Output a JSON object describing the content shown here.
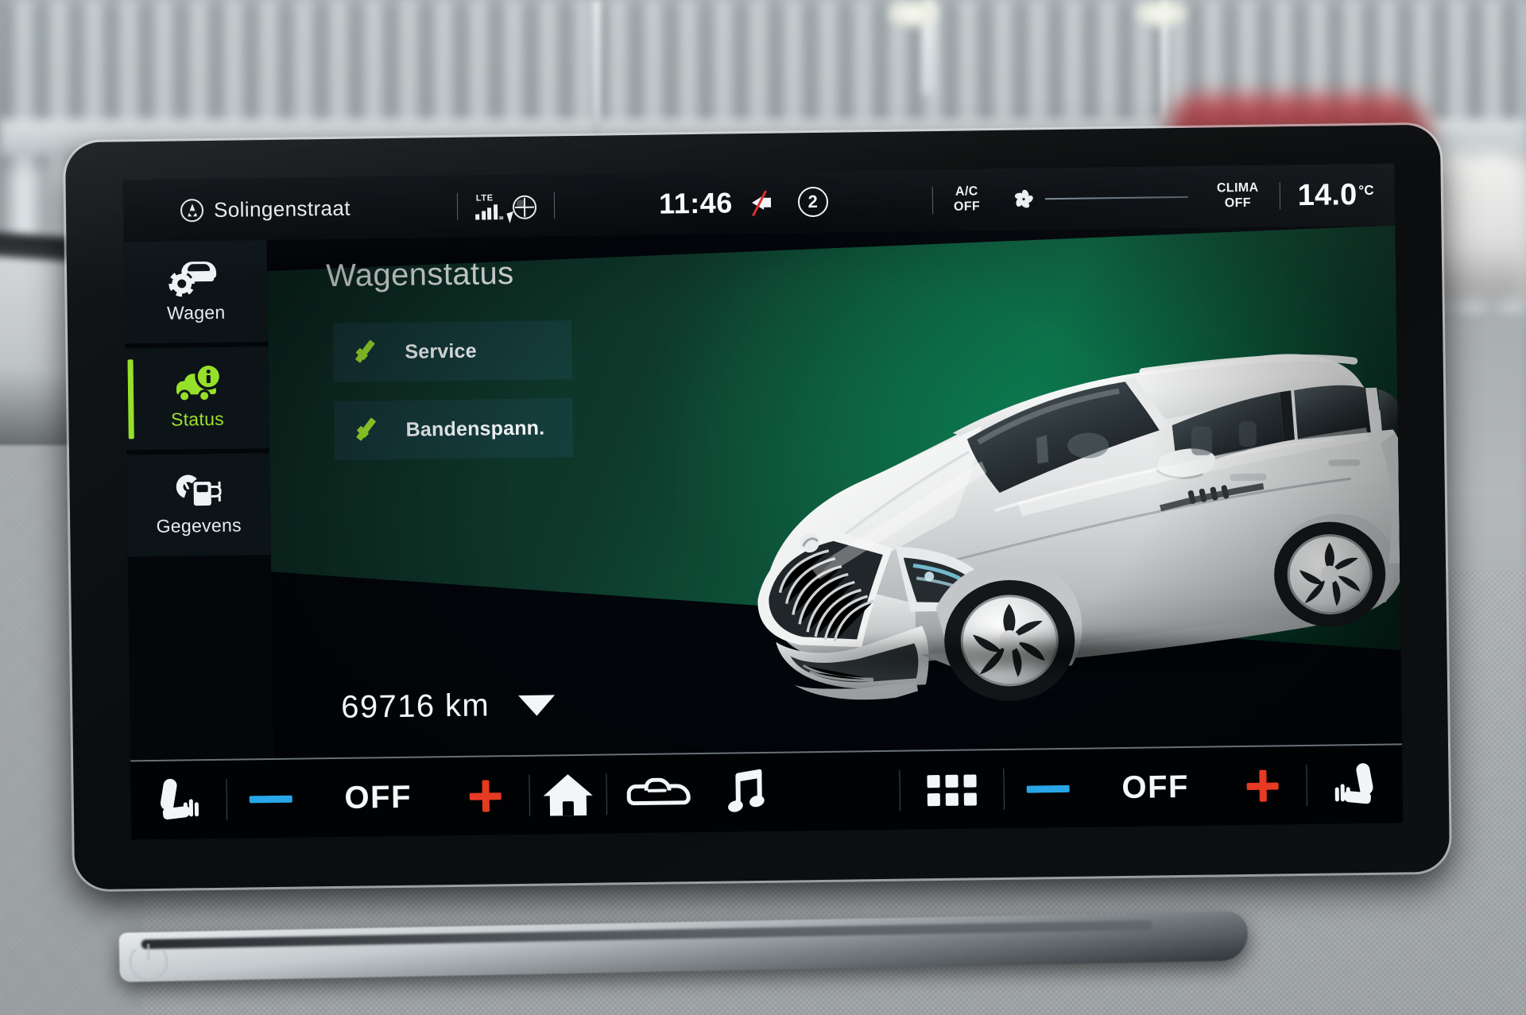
{
  "status_bar": {
    "nav_icon": "navigation-compass-icon",
    "street_name": "Solingenstraat",
    "network_label": "LTE",
    "signal_icon": "signal-bars-icon",
    "globe_icon": "globe-online-icon",
    "time": "11:46",
    "mute_icon": "speaker-muted-icon",
    "profile_number": "2",
    "ac_label_line1": "A/C",
    "ac_label_line2": "OFF",
    "fan_icon": "fan-blower-icon",
    "clima_label_line1": "CLIMA",
    "clima_label_line2": "OFF",
    "temperature": "14.0",
    "temperature_unit": "°C"
  },
  "sidebar": {
    "items": [
      {
        "label": "Wagen",
        "icon": "car-settings-icon",
        "active": false
      },
      {
        "label": "Status",
        "icon": "car-info-icon",
        "active": true
      },
      {
        "label": "Gegevens",
        "icon": "fuel-charge-icon",
        "active": false
      }
    ]
  },
  "main": {
    "title": "Wagenstatus",
    "status_items": [
      {
        "label": "Service",
        "state_icon": "check-icon"
      },
      {
        "label": "Bandenspann.",
        "state_icon": "check-icon"
      }
    ],
    "odometer": "69716 km",
    "odometer_caret_icon": "chevron-down-icon",
    "vehicle_image": "skoda-enyaq-white-render"
  },
  "bottom_bar": {
    "left_seat_icon": "seat-heater-left-icon",
    "left_minus_icon": "minus-icon",
    "left_value": "OFF",
    "left_plus_icon": "plus-icon",
    "home_icon": "home-icon",
    "vehicle_icon": "car-outline-icon",
    "media_icon": "music-note-icon",
    "apps_icon": "apps-grid-icon",
    "right_minus_icon": "minus-icon",
    "right_value": "OFF",
    "right_plus_icon": "plus-icon",
    "right_seat_icon": "seat-heater-right-icon"
  },
  "hardware": {
    "power_button_icon": "power-button-icon"
  },
  "colors": {
    "accent_green": "#96e02a",
    "panel_green": "#0b6b45",
    "minus_blue": "#29a6e8",
    "plus_red": "#e63a23",
    "text_white": "#f2f6f8"
  }
}
